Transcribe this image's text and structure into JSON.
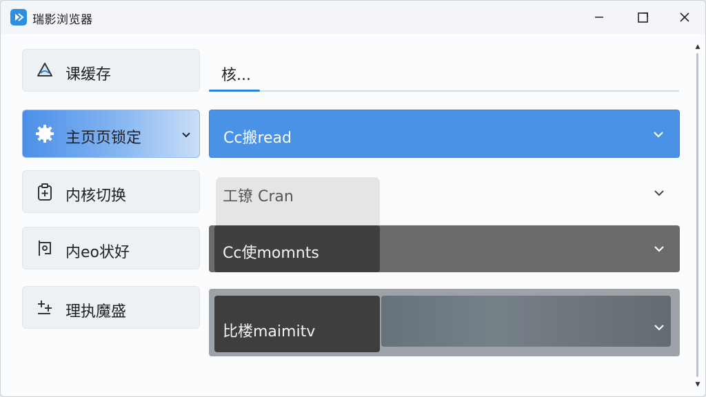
{
  "window": {
    "title": "瑞影浏览器",
    "controls": {
      "minimize": "—",
      "maximize": "☐",
      "close": "✕"
    }
  },
  "sidebar": {
    "items": [
      {
        "label": "课缓存",
        "icon": "cloud-warning-icon"
      },
      {
        "label": "主页页锁定",
        "icon": "gear-icon",
        "active": true
      },
      {
        "label": "内核切换",
        "icon": "add-doc-icon"
      },
      {
        "label": "内eo状好",
        "icon": "bracket-icon"
      },
      {
        "label": "理执魔盛",
        "icon": "plus-minus-icon"
      }
    ]
  },
  "main": {
    "search": {
      "value": "核..."
    },
    "dropdowns": [
      {
        "value": "Cc搬read"
      },
      {
        "value": "工镣 Cran"
      },
      {
        "value": "Cc使momnts"
      },
      {
        "value": "比楼maimitv"
      }
    ]
  },
  "colors": {
    "accent": "#4a92e6",
    "tab_underline": "#2f80d8",
    "titlebar": "#f3f5f8"
  }
}
